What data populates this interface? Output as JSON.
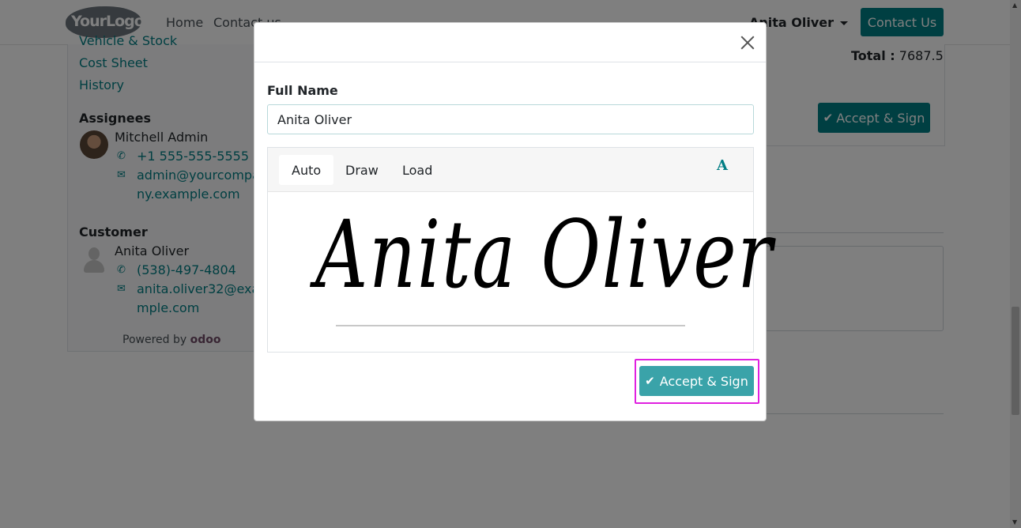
{
  "navbar": {
    "logo_text": "YourLogo",
    "links": [
      "Home",
      "Contact us"
    ],
    "user_name": "Anita Oliver",
    "contact_button": "Contact Us"
  },
  "sidebar": {
    "partial_link": "Vehicle & Stock",
    "links": [
      "Cost Sheet",
      "History"
    ],
    "assignees_heading": "Assignees",
    "assignee": {
      "name": "Mitchell Admin",
      "phone": "+1 555-555-5555",
      "email_line1": "admin@yourcompa",
      "email_line2": "ny.example.com"
    },
    "customer_heading": "Customer",
    "customer": {
      "name": "Anita Oliver",
      "phone": "(538)-497-4804",
      "email_line1": "anita.oliver32@exa",
      "email_line2": "mple.com"
    },
    "powered_by": "Powered by",
    "powered_brand": "odoo"
  },
  "main": {
    "total_label": "Total :",
    "total_value": "7687.5",
    "accept_button": "Accept & Sign"
  },
  "modal": {
    "full_name_label": "Full Name",
    "full_name_value": "Anita Oliver",
    "tabs": [
      "Auto",
      "Draw",
      "Load"
    ],
    "active_tab": "Auto",
    "font_button": "A",
    "signature_text": "Anita Oliver",
    "accept_button": "Accept & Sign"
  },
  "colors": {
    "primary": "#017e84",
    "modal_button": "#3aa3a9",
    "highlight": "#e020e0"
  },
  "icons": {
    "close": "close-icon",
    "check": "check-icon",
    "phone": "phone-icon",
    "email": "envelope-icon",
    "caret": "caret-down-icon"
  }
}
